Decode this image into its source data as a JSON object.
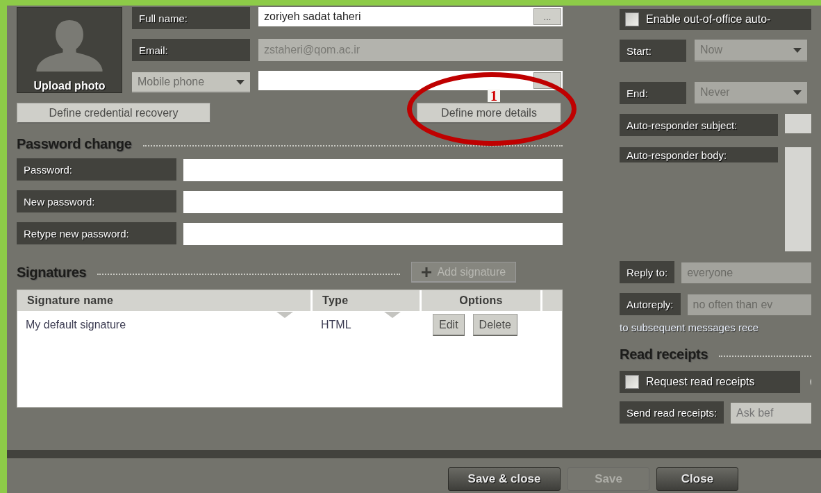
{
  "profile": {
    "upload_photo": "Upload photo",
    "fields": [
      {
        "kind": "text",
        "label": "Full name:",
        "value": "zoriyeh sadat taheri",
        "button": "..."
      },
      {
        "kind": "readonly",
        "label": "Email:",
        "value": "zstaheri@qom.ac.ir"
      },
      {
        "kind": "phone",
        "label": "Mobile phone"
      }
    ]
  },
  "actions": [
    "Define credential recovery",
    "Define more details"
  ],
  "annotation": {
    "label": "1"
  },
  "password_change": {
    "title": "Password change",
    "fields": [
      {
        "label": "Password:"
      },
      {
        "label": "New password:"
      },
      {
        "label": "Retype new password:"
      }
    ]
  },
  "signatures": {
    "title": "Signatures",
    "add_button": {
      "label": "Add signature",
      "disabled": true
    },
    "columns": [
      "Signature name",
      "Type",
      "Options"
    ],
    "rows": [
      {
        "name": "My default signature",
        "type": "HTML",
        "actions": [
          "Edit",
          "Delete"
        ]
      }
    ]
  },
  "out_of_office": {
    "enable": {
      "label": "Enable out-of-office auto-",
      "checked": false
    },
    "start": {
      "label": "Start:",
      "value": "Now",
      "disabled": true
    },
    "end": {
      "label": "End:",
      "value": "Never",
      "disabled": true
    },
    "subject_label": "Auto-responder subject:",
    "body_label": "Auto-responder body:",
    "reply_to": {
      "label": "Reply to:",
      "value": "everyone"
    },
    "autoreply": {
      "label": "Autoreply:",
      "value": "no often than ev"
    },
    "note": "to subsequent messages rece"
  },
  "read_receipts": {
    "title": "Read receipts",
    "request": {
      "label": "Request read receipts",
      "checked": false
    },
    "send": {
      "label": "Send read receipts:",
      "value": "Ask bef"
    }
  },
  "footer": [
    {
      "label": "Save & close",
      "disabled": false
    },
    {
      "label": "Save",
      "disabled": true
    },
    {
      "label": "Close",
      "disabled": false
    }
  ]
}
